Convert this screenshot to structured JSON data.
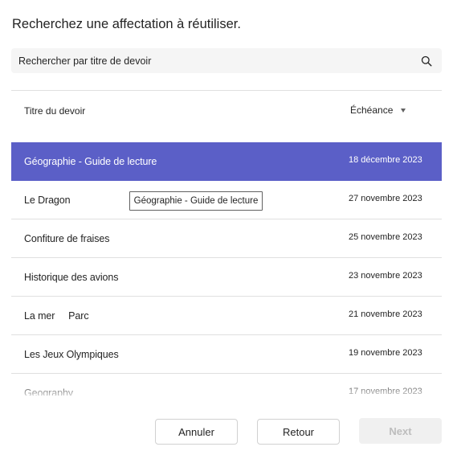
{
  "dialog": {
    "title": "Recherchez une affectation à réutiliser."
  },
  "search": {
    "placeholder": "Rechercher par titre de devoir",
    "icon": "search-icon"
  },
  "table": {
    "columns": {
      "title": "Titre du devoir",
      "due": "Échéance",
      "sort_icon": "caret-down-icon"
    },
    "rows": [
      {
        "title": "Géographie - Guide de lecture",
        "due": "18 décembre 2023",
        "selected": true
      },
      {
        "title": "Le Dragon",
        "due": "27 novembre 2023"
      },
      {
        "title": "Confiture de fraises",
        "due": "25 novembre 2023"
      },
      {
        "title": "Historique des avions",
        "due": "23 novembre 2023"
      },
      {
        "title": "La mer     Parc",
        "due": "21 novembre 2023"
      },
      {
        "title": "Les Jeux Olympiques",
        "due": "19 novembre 2023"
      },
      {
        "title": "Geography",
        "due": "17 novembre 2023"
      }
    ]
  },
  "tooltip": {
    "text": "Géographie - Guide de lecture"
  },
  "footer": {
    "cancel_label": "Annuler",
    "back_label": "Retour",
    "next_label": "Next",
    "next_disabled": true
  },
  "colors": {
    "accent": "#5b5fc7",
    "divider": "#e0e0e0",
    "search_bg": "#f5f5f5"
  }
}
